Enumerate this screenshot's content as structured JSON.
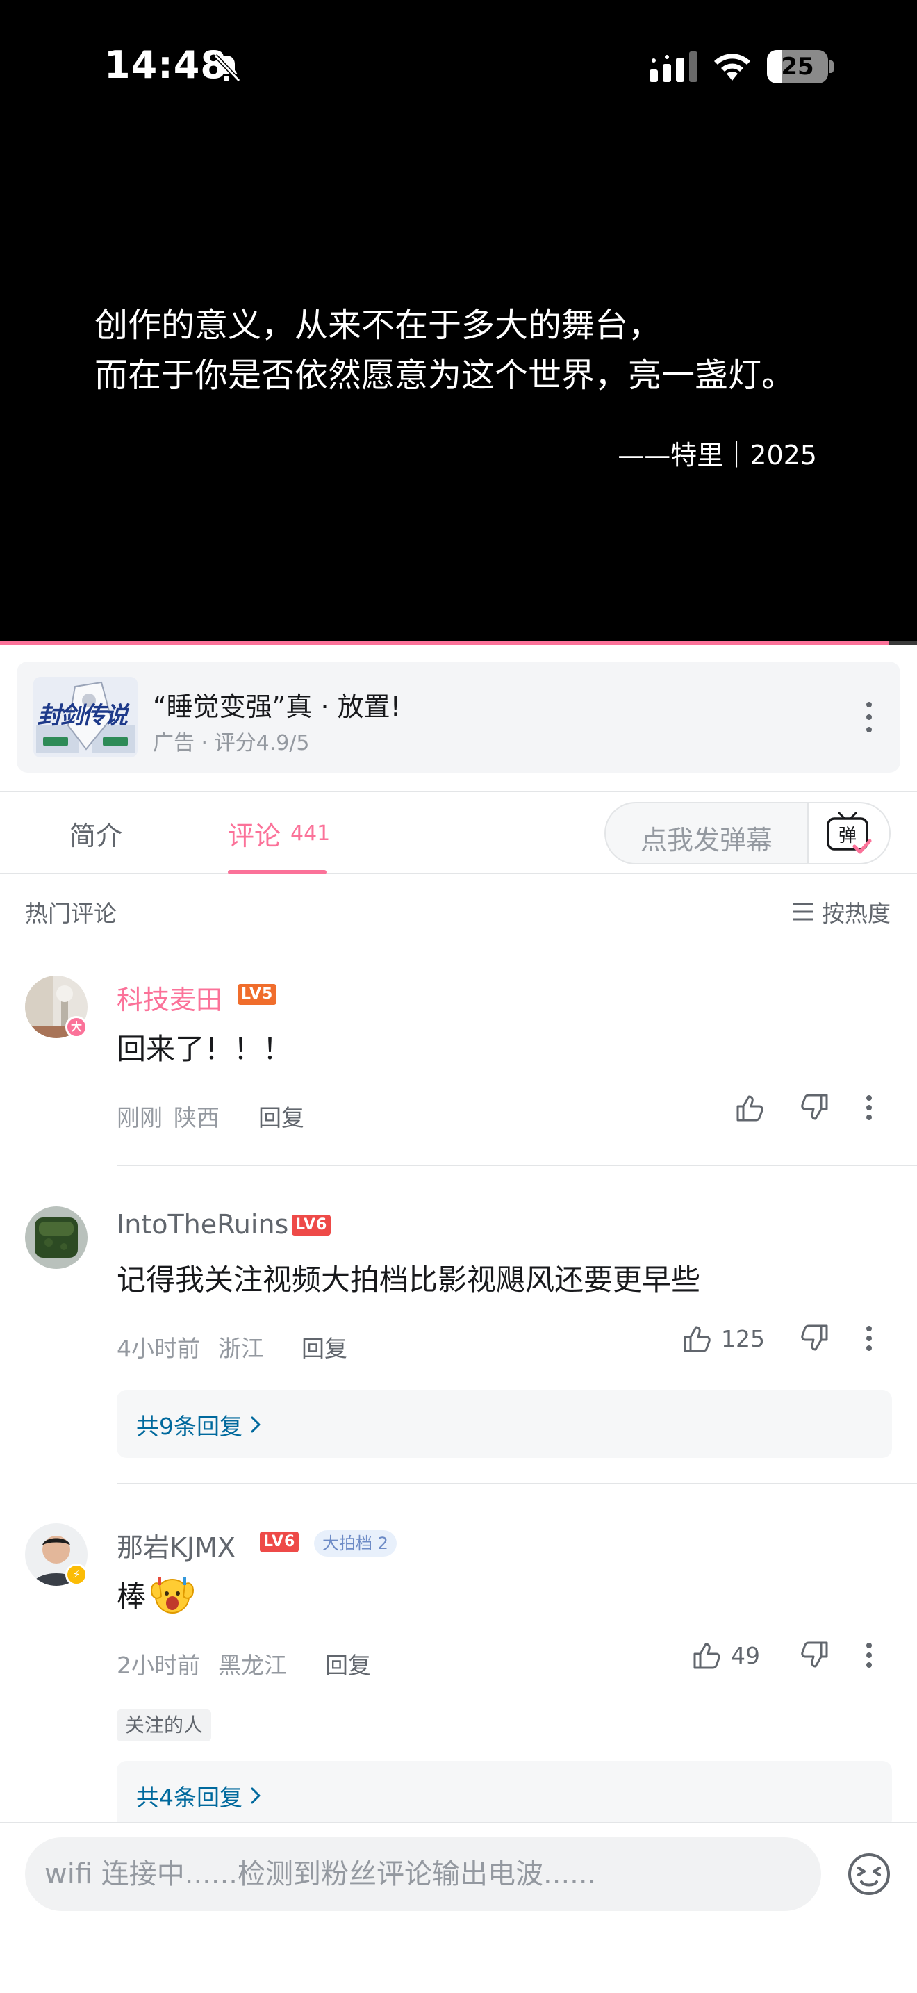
{
  "status_bar": {
    "time": "14:48",
    "battery_text": "25",
    "battery_fraction": 0.25
  },
  "video": {
    "quote_line1": "创作的意义，从来不在于多大的舞台，",
    "quote_line2": "而在于你是否依然愿意为这个世界，亮一盏灯。",
    "quote_signature": "——特里｜2025",
    "progress_fraction": 0.97,
    "progress_color": "#fb7299"
  },
  "ad": {
    "title": "“睡觉变强”真 · 放置!",
    "subtitle": "广告 · 评分4.9/5",
    "thumb_text": "封剑传说"
  },
  "tabs": {
    "intro_label": "简介",
    "comments_label": "评论",
    "comments_count": "441",
    "danmaku_placeholder": "点我发弹幕",
    "danmaku_icon_text": "弹"
  },
  "comments_section": {
    "heading": "热门评论",
    "sort_label": "按热度"
  },
  "comments": [
    {
      "username": "科技麦田",
      "level": "LV5",
      "avatar_badge": "大",
      "text": "回来了！！！",
      "time": "刚刚",
      "location": "陕西",
      "reply_label": "回复",
      "likes": ""
    },
    {
      "username": "IntoTheRuins",
      "level": "LV6",
      "text": "记得我关注视频大拍档比影视飓风还要更早些",
      "time": "4小时前",
      "location": "浙江",
      "reply_label": "回复",
      "likes": "125",
      "replies_label": "共9条回复"
    },
    {
      "username": "那岩KJMX",
      "level": "LV6",
      "fan_badge": "大拍档 2",
      "text": "棒",
      "time": "2小时前",
      "location": "黑龙江",
      "reply_label": "回复",
      "likes": "49",
      "tag": "关注的人",
      "replies_label": "共4条回复"
    }
  ],
  "bottom_input": {
    "placeholder": "wifi 连接中......检测到粉丝评论输出电波......"
  },
  "colors": {
    "accent": "#fb7299",
    "link": "#00699d",
    "lv5": "#f06d2c",
    "lv6": "#ee4a48"
  }
}
